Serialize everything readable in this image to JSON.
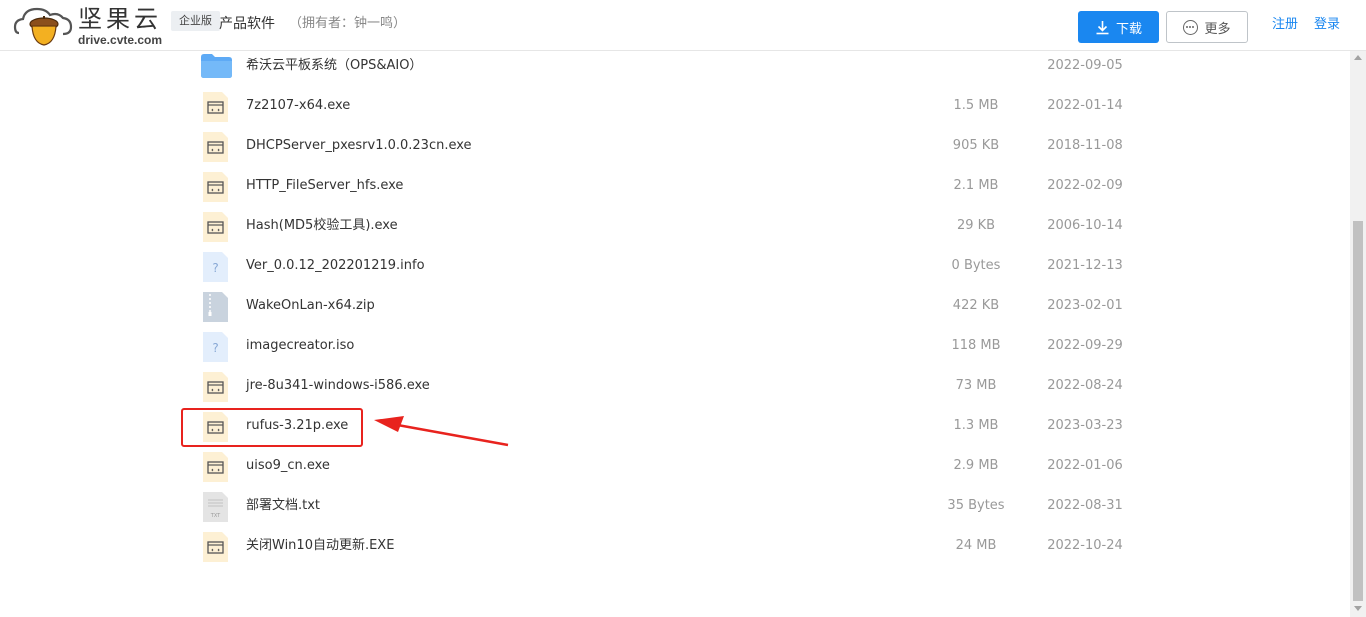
{
  "header": {
    "brand_name": "坚果云",
    "brand_domain": "drive.cvte.com",
    "edition_badge": "企业版",
    "folder_title": "产品软件",
    "owner": "（拥有者：钟一鸣）",
    "download_label": "下载",
    "more_label": "更多",
    "register_label": "注册",
    "login_label": "登录",
    "accent_color": "#1a87f0"
  },
  "files": [
    {
      "name": "希沃云平板系统（OPS&AIO）",
      "size": "",
      "date": "2022-09-05",
      "icon": "folder-icon"
    },
    {
      "name": "7z2107-x64.exe",
      "size": "1.5 MB",
      "date": "2022-01-14",
      "icon": "exe-file-icon"
    },
    {
      "name": "DHCPServer_pxesrv1.0.0.23cn.exe",
      "size": "905 KB",
      "date": "2018-11-08",
      "icon": "exe-file-icon"
    },
    {
      "name": "HTTP_FileServer_hfs.exe",
      "size": "2.1 MB",
      "date": "2022-02-09",
      "icon": "exe-file-icon"
    },
    {
      "name": "Hash(MD5校验工具).exe",
      "size": "29 KB",
      "date": "2006-10-14",
      "icon": "exe-file-icon"
    },
    {
      "name": "Ver_0.0.12_202201219.info",
      "size": "0 Bytes",
      "date": "2021-12-13",
      "icon": "unknown-file-icon"
    },
    {
      "name": "WakeOnLan-x64.zip",
      "size": "422 KB",
      "date": "2023-02-01",
      "icon": "zip-file-icon"
    },
    {
      "name": "imagecreator.iso",
      "size": "118 MB",
      "date": "2022-09-29",
      "icon": "unknown-file-icon"
    },
    {
      "name": "jre-8u341-windows-i586.exe",
      "size": "73 MB",
      "date": "2022-08-24",
      "icon": "exe-file-icon"
    },
    {
      "name": "rufus-3.21p.exe",
      "size": "1.3 MB",
      "date": "2023-03-23",
      "icon": "exe-file-icon"
    },
    {
      "name": "uiso9_cn.exe",
      "size": "2.9 MB",
      "date": "2022-01-06",
      "icon": "exe-file-icon"
    },
    {
      "name": "部署文档.txt",
      "size": "35 Bytes",
      "date": "2022-08-31",
      "icon": "txt-file-icon"
    },
    {
      "name": "关闭Win10自动更新.EXE",
      "size": "24 MB",
      "date": "2022-10-24",
      "icon": "exe-file-icon"
    }
  ],
  "annotation": {
    "highlighted_file": "rufus-3.21p.exe",
    "color": "#e8231e"
  }
}
